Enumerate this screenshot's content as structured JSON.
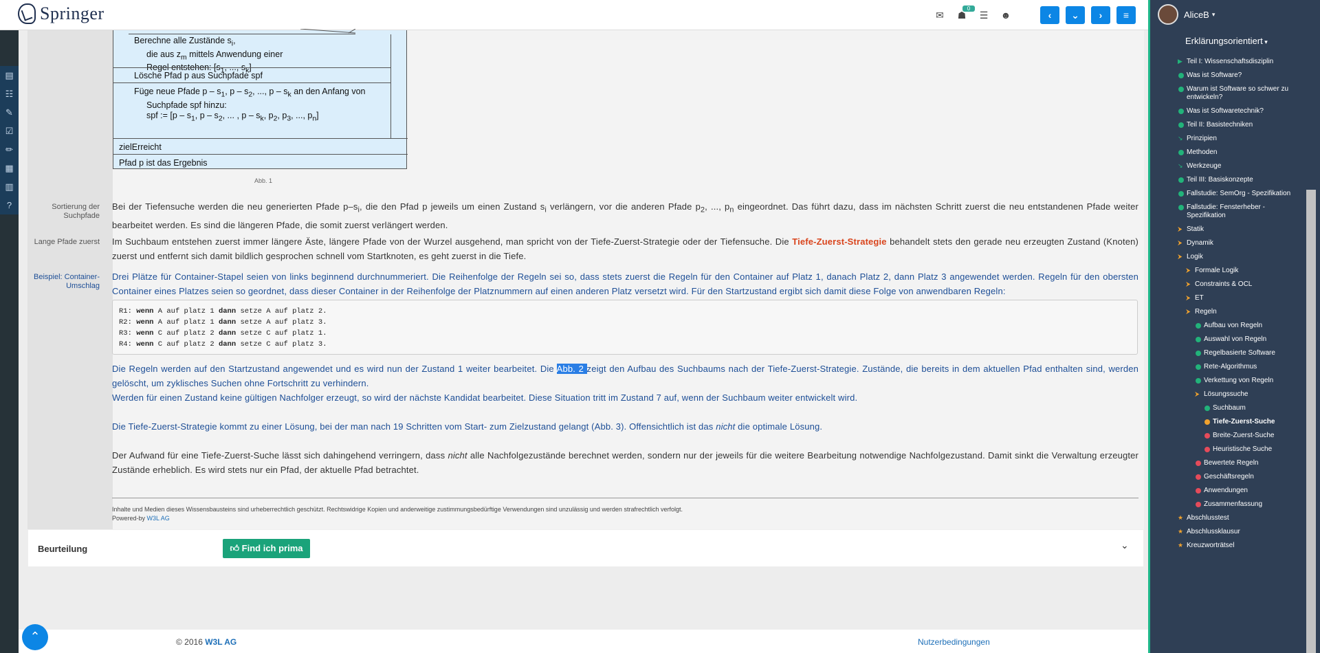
{
  "app": {
    "logo_text": "Springer",
    "user_name": "AliceB",
    "mode_label": "Erklärungsorientiert",
    "badge_count": "0"
  },
  "colors": {
    "accent": "#0c86e5",
    "highlight": "#d9441c",
    "link": "#1d4e96",
    "success": "#1aa37a",
    "sidebar_bg": "#2f3f55",
    "green": "#22b37a",
    "orange": "#f0a22e",
    "red": "#e54b5a"
  },
  "figure": {
    "rows": [
      {
        "line1": "Berechne alle Zustände s",
        "line1_sub": "i",
        "line1_end": ",",
        "line2": "die aus z",
        "line2_sub": "m",
        "line2_end": " mittels Anwendung einer",
        "line3": "Regel entstehen: [s",
        "line3_sub1": "1",
        "line3_mid": ", ..., s",
        "line3_sub2": "k",
        "line3_end": "]"
      },
      {
        "text": "Lösche Pfad p aus Suchpfade spf"
      },
      {
        "line1": "Füge neue Pfade p – s",
        "line1_sub": "1",
        "line1_end": ", p – s",
        "line1_sub2": "2",
        "line1_end2": ", ..., p – s",
        "line1_sub3": "k",
        "line1_end3": " an den Anfang von",
        "line2": "Suchpfade spf hinzu:",
        "line3": "spf := [p – s",
        "line3_sub1": "1",
        "line3_mid": ", p – s",
        "line3_sub2": "2",
        "line3_mid2": ", ... , p – s",
        "line3_sub3": "k",
        "line3_mid3": ", p",
        "line3_sub4": "2",
        "line3_mid4": ", p",
        "line3_sub5": "3",
        "line3_end": ", ..., p",
        "line3_sub6": "n",
        "line3_end2": "]"
      },
      {
        "text": "zielErreicht"
      },
      {
        "text": "Pfad p ist das Ergebnis"
      }
    ],
    "caption": "Abb. 1"
  },
  "sections": [
    {
      "label": "Sortierung der Suchpfade",
      "text_a": "Bei der Tiefensuche werden die neu generierten Pfade p–s",
      "sub_a": "i",
      "text_b": ", die den Pfad p jeweils um einen Zustand s",
      "sub_b": "i",
      "text_c": " verlängern, vor die anderen Pfade p",
      "sub_c": "2",
      "text_d": ", ..., p",
      "sub_d": "n",
      "text_e": " eingeordnet. Das führt dazu, dass im nächsten Schritt zuerst die neu entstandenen Pfade weiter bearbeitet werden. Es sind die längeren Pfade, die somit zuerst verlängert werden."
    },
    {
      "label": "Lange Pfade zuerst",
      "text_a": "Im Suchbaum entstehen zuerst immer längere Äste, längere Pfade von der Wurzel ausgehend, man spricht von der Tiefe-Zuerst-Strategie oder der Tiefensuche. Die ",
      "highlight": "Tiefe-Zuerst-Strategie",
      "text_b": " behandelt stets den gerade neu erzeugten Zustand (Knoten) zuerst und entfernt sich damit bildlich gesprochen schnell vom Startknoten, es geht zuerst in die Tiefe."
    },
    {
      "label": "Beispiel: Container-Umschlag",
      "text": "Drei Plätze für Container-Stapel seien von links beginnend durchnummeriert. Die Reihenfolge der Regeln sei so, dass stets zuerst die Regeln für den Container auf Platz 1, danach Platz 2, dann Platz 3 angewendet werden. Regeln für den obersten Container eines Platzes seien so geordnet, dass dieser Container in der Reihenfolge der Platznummern auf einen anderen Platz versetzt wird. Für den Startzustand ergibt sich damit diese Folge von anwendbaren Regeln:"
    }
  ],
  "code_lines": [
    {
      "pre": "R1: ",
      "kw1": "wenn",
      "mid": " A auf platz 1 ",
      "kw2": "dann",
      "post": " setze A auf platz 2."
    },
    {
      "pre": "R2: ",
      "kw1": "wenn",
      "mid": " A auf platz 1 ",
      "kw2": "dann",
      "post": " setze A auf platz 3."
    },
    {
      "pre": "R3: ",
      "kw1": "wenn",
      "mid": " C auf platz 2 ",
      "kw2": "dann",
      "post": " setze C auf platz 1."
    },
    {
      "pre": "R4: ",
      "kw1": "wenn",
      "mid": " C auf platz 2 ",
      "kw2": "dann",
      "post": " setze C auf platz 3."
    }
  ],
  "after": {
    "p1_a": "Die Regeln werden auf den Startzustand angewendet und es wird nun der Zustand 1 weiter bearbeitet. Die ",
    "p1_sel": "Abb. 2 ",
    "p1_b": "zeigt den Aufbau des Suchbaums nach der Tiefe-Zuerst-Strategie. Zustände, die bereits in dem aktuellen Pfad enthalten sind, werden gelöscht, um zyklisches Suchen ohne Fortschritt zu verhindern.",
    "p1_c": "Werden für einen Zustand keine gültigen Nachfolger erzeugt, so wird der nächste Kandidat bearbeitet. Diese Situation tritt im Zustand 7 auf, wenn der Suchbaum weiter entwickelt wird.",
    "p2_a": "Die Tiefe-Zuerst-Strategie kommt zu einer Lösung, bei der man nach 19 Schritten vom Start- zum Zielzustand gelangt (Abb. 3). Offensichtlich ist das ",
    "p2_em": "nicht",
    "p2_b": " die optimale Lösung.",
    "p3_a": "Der Aufwand für eine Tiefe-Zuerst-Suche lässt sich dahingehend verringern, dass ",
    "p3_em": "nicht",
    "p3_b": " alle Nachfolgezustände berechnet werden, sondern nur der jeweils für die weitere Bearbeitung notwendige Nachfolgezustand. Damit sinkt die Verwaltung erzeugter Zustände erheblich. Es wird stets nur ein Pfad, der aktuelle Pfad betrachtet."
  },
  "notice": {
    "text": "Inhalte und Medien dieses Wissensbausteins sind urheberrechtlich geschützt. Rechtswidrige Kopien und anderweitige zustimmungsbedürftige Verwendungen sind unzulässig und werden strafrechtlich verfolgt.",
    "powered_prefix": "Powered-by ",
    "powered_link": "W3L AG"
  },
  "rating": {
    "label": "Beurteilung",
    "button": "Find ich prima"
  },
  "footer": {
    "copy_prefix": "© 2016 ",
    "copy_company": "W3L AG",
    "terms": "Nutzerbedingungen"
  },
  "toc": [
    {
      "label": "Teil I: Wissenschaftsdisziplin",
      "marker": "arrow",
      "color": "green",
      "level": 0
    },
    {
      "label": "Was ist Software?",
      "marker": "dot",
      "color": "green",
      "level": 0
    },
    {
      "label": "Warum ist Software so schwer zu entwickeln?",
      "marker": "dot",
      "color": "green",
      "level": 0
    },
    {
      "label": "Was ist Softwaretechnik?",
      "marker": "dot",
      "color": "green",
      "level": 0
    },
    {
      "label": "Teil II: Basistechniken",
      "marker": "dot",
      "color": "green",
      "level": 0
    },
    {
      "label": "Prinzipien",
      "marker": "partial",
      "color": "green",
      "level": 0
    },
    {
      "label": "Methoden",
      "marker": "dot",
      "color": "green",
      "level": 0
    },
    {
      "label": "Werkzeuge",
      "marker": "partial",
      "color": "green",
      "level": 0
    },
    {
      "label": "Teil III: Basiskonzepte",
      "marker": "dot",
      "color": "green",
      "level": 0
    },
    {
      "label": "Fallstudie: SemOrg - Spezifikation",
      "marker": "dot",
      "color": "green",
      "level": 0
    },
    {
      "label": "Fallstudie: Fensterheber - Spezifikation",
      "marker": "dot",
      "color": "green",
      "level": 0
    },
    {
      "label": "Statik",
      "marker": "open",
      "color": "orange",
      "level": 0
    },
    {
      "label": "Dynamik",
      "marker": "open",
      "color": "orange",
      "level": 0
    },
    {
      "label": "Logik",
      "marker": "open",
      "color": "orange",
      "level": 0
    },
    {
      "label": "Formale Logik",
      "marker": "open",
      "color": "orange",
      "level": 1
    },
    {
      "label": "Constraints & OCL",
      "marker": "open",
      "color": "orange",
      "level": 1
    },
    {
      "label": "ET",
      "marker": "open",
      "color": "orange",
      "level": 1
    },
    {
      "label": "Regeln",
      "marker": "open",
      "color": "orange",
      "level": 1
    },
    {
      "label": "Aufbau von Regeln",
      "marker": "dot",
      "color": "green",
      "level": 2
    },
    {
      "label": "Auswahl von Regeln",
      "marker": "dot",
      "color": "green",
      "level": 2
    },
    {
      "label": "Regelbasierte Software",
      "marker": "dot",
      "color": "green",
      "level": 2
    },
    {
      "label": "Rete-Algorithmus",
      "marker": "dot",
      "color": "green",
      "level": 2
    },
    {
      "label": "Verkettung von Regeln",
      "marker": "dot",
      "color": "green",
      "level": 2
    },
    {
      "label": "Lösungssuche",
      "marker": "open",
      "color": "orange",
      "level": 2
    },
    {
      "label": "Suchbaum",
      "marker": "dot",
      "color": "green",
      "level": 3
    },
    {
      "label": "Tiefe-Zuerst-Suche",
      "marker": "dot",
      "color": "orange",
      "level": 3,
      "current": true
    },
    {
      "label": "Breite-Zuerst-Suche",
      "marker": "dot",
      "color": "red",
      "level": 3
    },
    {
      "label": "Heuristische Suche",
      "marker": "dot",
      "color": "red",
      "level": 3
    },
    {
      "label": "Bewertete Regeln",
      "marker": "dot",
      "color": "red",
      "level": 2
    },
    {
      "label": "Geschäftsregeln",
      "marker": "dot",
      "color": "red",
      "level": 2
    },
    {
      "label": "Anwendungen",
      "marker": "dot",
      "color": "red",
      "level": 2
    },
    {
      "label": "Zusammenfassung",
      "marker": "dot",
      "color": "red",
      "level": 2
    },
    {
      "label": "Abschlusstest",
      "marker": "star",
      "color": "orange",
      "level": 0
    },
    {
      "label": "Abschlussklausur",
      "marker": "star",
      "color": "orange",
      "level": 0
    },
    {
      "label": "Kreuzworträtsel",
      "marker": "star",
      "color": "orange",
      "level": 0
    }
  ]
}
